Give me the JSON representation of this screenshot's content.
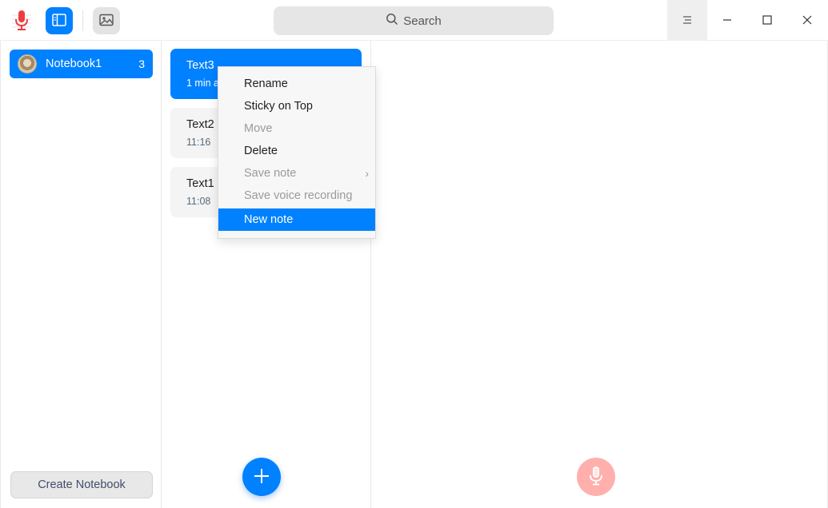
{
  "titlebar": {
    "search_placeholder": "Search",
    "icons": [
      "voice-notes-app-icon",
      "sidebar-toggle-icon",
      "image-icon",
      "search-icon",
      "menu-icon",
      "minimize-icon",
      "maximize-icon",
      "close-icon"
    ]
  },
  "notebooks": {
    "items": [
      {
        "name": "Notebook1",
        "count": "3"
      }
    ],
    "create_label": "Create Notebook"
  },
  "notes": [
    {
      "title": "Text3",
      "time": "1 min a",
      "active": true
    },
    {
      "title": "Text2",
      "time": "11:16",
      "active": false
    },
    {
      "title": "Text1",
      "time": "11:08",
      "active": false
    }
  ],
  "context_menu": {
    "items": [
      {
        "label": "Rename",
        "enabled": true
      },
      {
        "label": "Sticky on Top",
        "enabled": true
      },
      {
        "label": "Move",
        "enabled": false
      },
      {
        "label": "Delete",
        "enabled": true
      },
      {
        "label": "Save note",
        "enabled": false,
        "submenu": true
      },
      {
        "label": "Save voice recording",
        "enabled": false
      },
      {
        "label": "New note",
        "enabled": true,
        "highlighted": true
      }
    ]
  },
  "colors": {
    "accent": "#0081ff",
    "record_button": "#ffb0ad"
  }
}
